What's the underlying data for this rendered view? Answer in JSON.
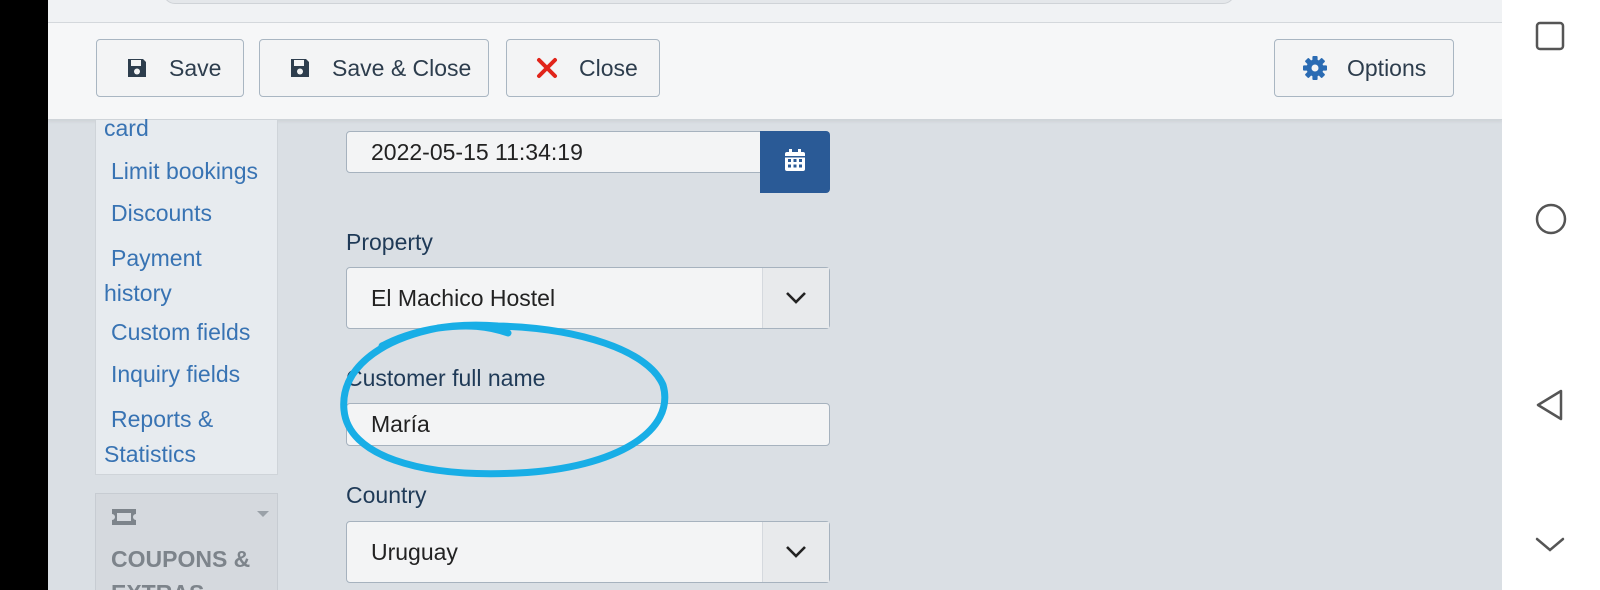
{
  "toolbar": {
    "save_label": "Save",
    "save_close_label": "Save & Close",
    "close_label": "Close",
    "options_label": "Options"
  },
  "sidebar": {
    "items": [
      {
        "label": "card"
      },
      {
        "label": "Limit bookings"
      },
      {
        "label": "Discounts"
      },
      {
        "label": "Payment history"
      },
      {
        "label": "Custom fields"
      },
      {
        "label": "Inquiry fields"
      },
      {
        "label": "Reports & Statistics"
      }
    ],
    "coupons_section": {
      "label": "COUPONS & EXTRAS",
      "icon": "ticket-icon"
    }
  },
  "form": {
    "date": {
      "value": "2022-05-15 11:34:19",
      "icon": "calendar-icon"
    },
    "property": {
      "label": "Property",
      "value": "El Machico Hostel"
    },
    "customer": {
      "label": "Customer full name",
      "value": "María"
    },
    "country": {
      "label": "Country",
      "value": "Uruguay"
    }
  },
  "annotation": {
    "color": "#18aee6"
  },
  "colors": {
    "accent": "#2a5a96",
    "link": "#3873b3",
    "close_red": "#e1241a"
  },
  "android_nav": [
    "recents-icon",
    "home-icon",
    "back-icon",
    "keyboard-hide-icon"
  ]
}
